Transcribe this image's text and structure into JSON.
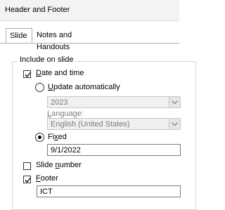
{
  "dialog": {
    "title": "Header and Footer"
  },
  "tabs": [
    {
      "label": "Slide"
    },
    {
      "label": "Notes and Handouts"
    }
  ],
  "group": {
    "label": "Include on slide"
  },
  "date_time": {
    "checkbox_label": "Date and time",
    "checked": true,
    "update_auto_label": "Update automatically",
    "update_selected": false,
    "date_format_value": "2023",
    "language_label": "Language:",
    "language_value": "English (United States)",
    "fixed_label": "Fixed",
    "fixed_selected": true,
    "fixed_value": "9/1/2022"
  },
  "slide_number": {
    "label": "Slide number",
    "checked": false
  },
  "footer": {
    "label": "Footer",
    "checked": true,
    "value": "ICT"
  }
}
